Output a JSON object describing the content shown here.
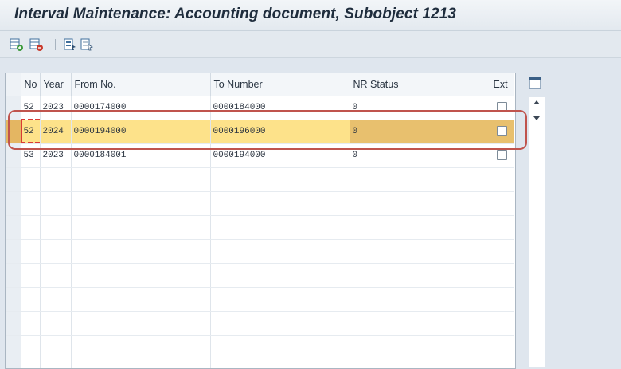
{
  "window": {
    "title": "Interval Maintenance: Accounting document, Subobject 1213"
  },
  "toolbar": {
    "buttons": [
      {
        "icon": "insert-row-icon"
      },
      {
        "icon": "delete-row-icon"
      },
      {
        "icon": "select-all-icon"
      },
      {
        "icon": "deselect-all-icon"
      }
    ]
  },
  "table": {
    "columns": {
      "no": "No",
      "year": "Year",
      "from": "From No.",
      "to": "To Number",
      "status": "NR Status",
      "ext": "Ext"
    },
    "rows": [
      {
        "no": "52",
        "year": "2023",
        "from": "0000174000",
        "to": "0000184000",
        "status": "0",
        "ext": false
      },
      {
        "no": "52",
        "year": "2024",
        "from": "0000194000",
        "to": "0000196000",
        "status": "0",
        "ext": false
      },
      {
        "no": "53",
        "year": "2023",
        "from": "0000184001",
        "to": "0000194000",
        "status": "0",
        "ext": false
      }
    ],
    "selected_row": 1
  },
  "colors": {
    "highlight": "#fde28a",
    "annotation": "#c0544d"
  }
}
